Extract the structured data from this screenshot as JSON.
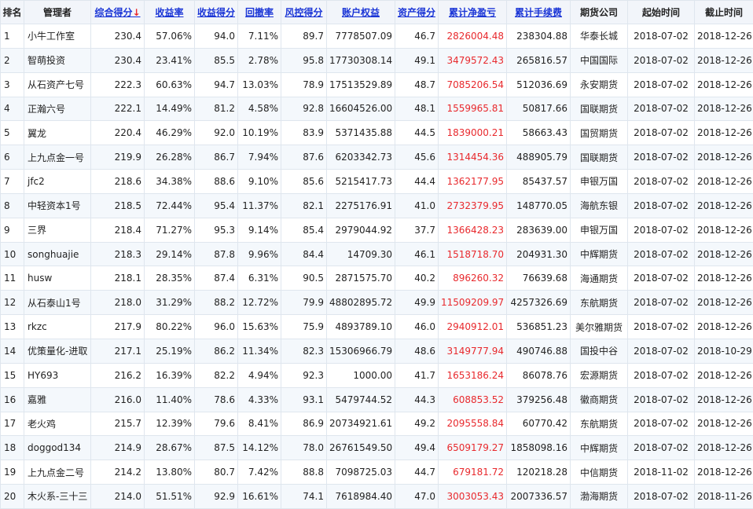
{
  "headers": {
    "rank": "排名",
    "manager": "管理者",
    "composite": "综合得分",
    "composite_arrow": "↓",
    "return_rate": "收益率",
    "return_score": "收益得分",
    "drawdown": "回撤率",
    "risk_score": "风控得分",
    "equity": "账户权益",
    "asset_score": "资产得分",
    "net_pl": "累计净盈亏",
    "fees": "累计手续费",
    "broker": "期货公司",
    "start": "起始时间",
    "end": "截止时间"
  },
  "rows": [
    {
      "rank": "1",
      "manager": "小牛工作室",
      "composite": "230.4",
      "return_rate": "57.06%",
      "return_score": "94.0",
      "drawdown": "7.11%",
      "risk_score": "89.7",
      "equity": "7778507.09",
      "asset_score": "46.7",
      "net_pl": "2826004.48",
      "fees": "238304.88",
      "broker": "华泰长城",
      "start": "2018-07-02",
      "end": "2018-12-26"
    },
    {
      "rank": "2",
      "manager": "智萌投资",
      "composite": "230.4",
      "return_rate": "23.41%",
      "return_score": "85.5",
      "drawdown": "2.78%",
      "risk_score": "95.8",
      "equity": "17730308.14",
      "asset_score": "49.1",
      "net_pl": "3479572.43",
      "fees": "265816.57",
      "broker": "中国国际",
      "start": "2018-07-02",
      "end": "2018-12-26"
    },
    {
      "rank": "3",
      "manager": "从石资产七号",
      "composite": "222.3",
      "return_rate": "60.63%",
      "return_score": "94.7",
      "drawdown": "13.03%",
      "risk_score": "78.9",
      "equity": "17513529.89",
      "asset_score": "48.7",
      "net_pl": "7085206.54",
      "fees": "512036.69",
      "broker": "永安期货",
      "start": "2018-07-02",
      "end": "2018-12-26"
    },
    {
      "rank": "4",
      "manager": "正瀚六号",
      "composite": "222.1",
      "return_rate": "14.49%",
      "return_score": "81.2",
      "drawdown": "4.58%",
      "risk_score": "92.8",
      "equity": "16604526.00",
      "asset_score": "48.1",
      "net_pl": "1559965.81",
      "fees": "50817.66",
      "broker": "国联期货",
      "start": "2018-07-02",
      "end": "2018-12-26"
    },
    {
      "rank": "5",
      "manager": "翼龙",
      "composite": "220.4",
      "return_rate": "46.29%",
      "return_score": "92.0",
      "drawdown": "10.19%",
      "risk_score": "83.9",
      "equity": "5371435.88",
      "asset_score": "44.5",
      "net_pl": "1839000.21",
      "fees": "58663.43",
      "broker": "国贸期货",
      "start": "2018-07-02",
      "end": "2018-12-26"
    },
    {
      "rank": "6",
      "manager": "上九点金一号",
      "composite": "219.9",
      "return_rate": "26.28%",
      "return_score": "86.7",
      "drawdown": "7.94%",
      "risk_score": "87.6",
      "equity": "6203342.73",
      "asset_score": "45.6",
      "net_pl": "1314454.36",
      "fees": "488905.79",
      "broker": "国联期货",
      "start": "2018-07-02",
      "end": "2018-12-26"
    },
    {
      "rank": "7",
      "manager": "jfc2",
      "composite": "218.6",
      "return_rate": "34.38%",
      "return_score": "88.6",
      "drawdown": "9.10%",
      "risk_score": "85.6",
      "equity": "5215417.73",
      "asset_score": "44.4",
      "net_pl": "1362177.95",
      "fees": "85437.57",
      "broker": "申银万国",
      "start": "2018-07-02",
      "end": "2018-12-26"
    },
    {
      "rank": "8",
      "manager": "中轻资本1号",
      "composite": "218.5",
      "return_rate": "72.44%",
      "return_score": "95.4",
      "drawdown": "11.37%",
      "risk_score": "82.1",
      "equity": "2275176.91",
      "asset_score": "41.0",
      "net_pl": "2732379.95",
      "fees": "148770.05",
      "broker": "海航东银",
      "start": "2018-07-02",
      "end": "2018-12-26"
    },
    {
      "rank": "9",
      "manager": "三界",
      "composite": "218.4",
      "return_rate": "71.27%",
      "return_score": "95.3",
      "drawdown": "9.14%",
      "risk_score": "85.4",
      "equity": "2979044.92",
      "asset_score": "37.7",
      "net_pl": "1366428.23",
      "fees": "283639.00",
      "broker": "申银万国",
      "start": "2018-07-02",
      "end": "2018-12-26"
    },
    {
      "rank": "10",
      "manager": "songhuajie",
      "composite": "218.3",
      "return_rate": "29.14%",
      "return_score": "87.8",
      "drawdown": "9.96%",
      "risk_score": "84.4",
      "equity": "14709.30",
      "asset_score": "46.1",
      "net_pl": "1518718.70",
      "fees": "204931.30",
      "broker": "中辉期货",
      "start": "2018-07-02",
      "end": "2018-12-26"
    },
    {
      "rank": "11",
      "manager": "husw",
      "composite": "218.1",
      "return_rate": "28.35%",
      "return_score": "87.4",
      "drawdown": "6.31%",
      "risk_score": "90.5",
      "equity": "2871575.70",
      "asset_score": "40.2",
      "net_pl": "896260.32",
      "fees": "76639.68",
      "broker": "海通期货",
      "start": "2018-07-02",
      "end": "2018-12-26"
    },
    {
      "rank": "12",
      "manager": "从石泰山1号",
      "composite": "218.0",
      "return_rate": "31.29%",
      "return_score": "88.2",
      "drawdown": "12.72%",
      "risk_score": "79.9",
      "equity": "48802895.72",
      "asset_score": "49.9",
      "net_pl": "11509209.97",
      "fees": "4257326.69",
      "broker": "东航期货",
      "start": "2018-07-02",
      "end": "2018-12-26"
    },
    {
      "rank": "13",
      "manager": "rkzc",
      "composite": "217.9",
      "return_rate": "80.22%",
      "return_score": "96.0",
      "drawdown": "15.63%",
      "risk_score": "75.9",
      "equity": "4893789.10",
      "asset_score": "46.0",
      "net_pl": "2940912.01",
      "fees": "536851.23",
      "broker": "美尔雅期货",
      "start": "2018-07-02",
      "end": "2018-12-26"
    },
    {
      "rank": "14",
      "manager": "优策量化-进取",
      "composite": "217.1",
      "return_rate": "25.19%",
      "return_score": "86.2",
      "drawdown": "11.34%",
      "risk_score": "82.3",
      "equity": "15306966.79",
      "asset_score": "48.6",
      "net_pl": "3149777.94",
      "fees": "490746.88",
      "broker": "国投中谷",
      "start": "2018-07-02",
      "end": "2018-10-29"
    },
    {
      "rank": "15",
      "manager": "HY693",
      "composite": "216.2",
      "return_rate": "16.39%",
      "return_score": "82.2",
      "drawdown": "4.94%",
      "risk_score": "92.3",
      "equity": "1000.00",
      "asset_score": "41.7",
      "net_pl": "1653186.24",
      "fees": "86078.76",
      "broker": "宏源期货",
      "start": "2018-07-02",
      "end": "2018-12-26"
    },
    {
      "rank": "16",
      "manager": "嘉雅",
      "composite": "216.0",
      "return_rate": "11.40%",
      "return_score": "78.6",
      "drawdown": "4.33%",
      "risk_score": "93.1",
      "equity": "5479744.52",
      "asset_score": "44.3",
      "net_pl": "608853.52",
      "fees": "379256.48",
      "broker": "徽商期货",
      "start": "2018-07-02",
      "end": "2018-12-26"
    },
    {
      "rank": "17",
      "manager": "老火鸡",
      "composite": "215.7",
      "return_rate": "12.39%",
      "return_score": "79.6",
      "drawdown": "8.41%",
      "risk_score": "86.9",
      "equity": "20734921.61",
      "asset_score": "49.2",
      "net_pl": "2095558.84",
      "fees": "60770.42",
      "broker": "东航期货",
      "start": "2018-07-02",
      "end": "2018-12-26"
    },
    {
      "rank": "18",
      "manager": "doggod134",
      "composite": "214.9",
      "return_rate": "28.67%",
      "return_score": "87.5",
      "drawdown": "14.12%",
      "risk_score": "78.0",
      "equity": "26761549.50",
      "asset_score": "49.4",
      "net_pl": "6509179.27",
      "fees": "1858098.16",
      "broker": "中辉期货",
      "start": "2018-07-02",
      "end": "2018-12-26"
    },
    {
      "rank": "19",
      "manager": "上九点金二号",
      "composite": "214.2",
      "return_rate": "13.80%",
      "return_score": "80.7",
      "drawdown": "7.42%",
      "risk_score": "88.8",
      "equity": "7098725.03",
      "asset_score": "44.7",
      "net_pl": "679181.72",
      "fees": "120218.28",
      "broker": "中信期货",
      "start": "2018-11-02",
      "end": "2018-12-26"
    },
    {
      "rank": "20",
      "manager": "木火系-三十三",
      "composite": "214.0",
      "return_rate": "51.51%",
      "return_score": "92.9",
      "drawdown": "16.61%",
      "risk_score": "74.1",
      "equity": "7618984.40",
      "asset_score": "47.0",
      "net_pl": "3003053.43",
      "fees": "2007336.57",
      "broker": "渤海期货",
      "start": "2018-07-02",
      "end": "2018-11-26"
    }
  ]
}
